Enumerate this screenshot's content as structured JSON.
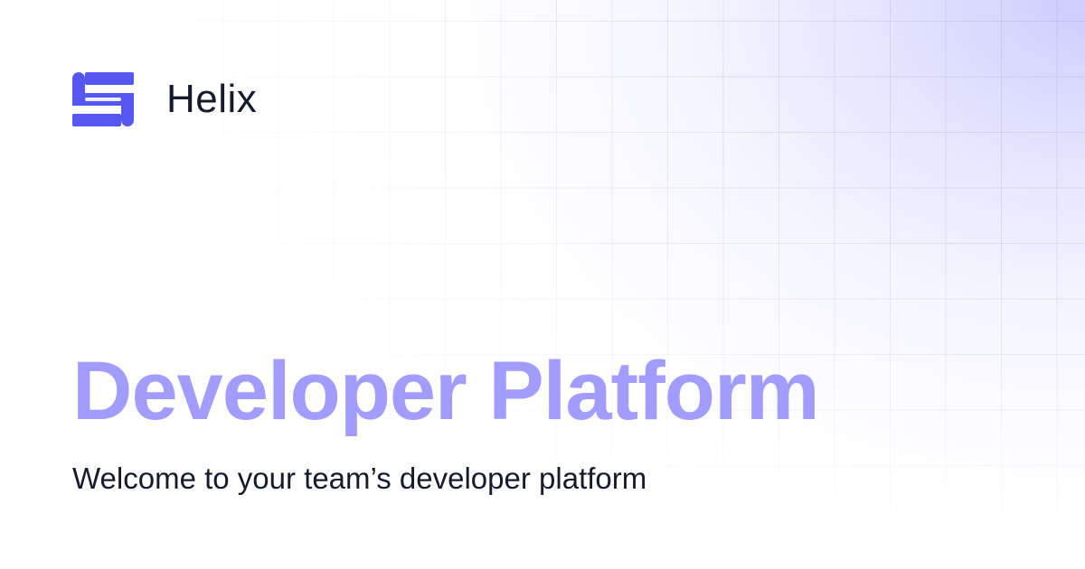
{
  "brand": {
    "name": "Helix",
    "logo_icon": "helix-s-logo-icon",
    "logo_color": "#5557f0"
  },
  "hero": {
    "title": "Developer Platform",
    "subtitle": "Welcome to your team’s developer platform"
  },
  "colors": {
    "title": "#a29cff",
    "text": "#161a2c",
    "background_glow": "#c4c4ff",
    "grid_line": "#9696b9"
  }
}
